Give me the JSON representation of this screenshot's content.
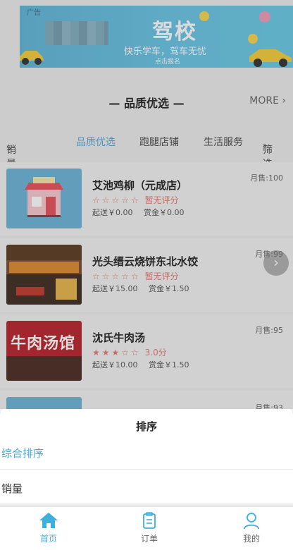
{
  "banner": {
    "ad_tag": "广告",
    "title": "驾校",
    "subtitle": "快乐学车，驾车无忧",
    "cta": "点击报名"
  },
  "section": {
    "title": "— 品质优选 —",
    "more": "MORE",
    "more_icon": "chevron-right-icon"
  },
  "tabs": {
    "sales": "销量",
    "quality": "品质优选",
    "errand": "跑腿店铺",
    "life": "生活服务",
    "filter": "筛选",
    "active_color": "#4fa7d8"
  },
  "shops": [
    {
      "name": "艾池鸡柳（元成店）",
      "sales": "月售:100",
      "stars": "☆☆☆☆☆",
      "rating": "暂无评分",
      "delivery": "起送￥0.00",
      "bounty": "赏金￥0.00"
    },
    {
      "name": "光头缙云烧饼东北水饺",
      "sales": "月售:99",
      "stars": "☆☆☆☆☆",
      "rating": "暂无评分",
      "delivery": "起送￥15.00",
      "bounty": "赏金￥1.50"
    },
    {
      "name": "沈氏牛肉汤",
      "sales": "月售:95",
      "stars": "★★★☆☆",
      "rating": "3.0分",
      "delivery": "起送￥10.00",
      "bounty": "赏金￥1.50",
      "thumb_text": "牛肉汤馆"
    },
    {
      "sales": "月售:93"
    }
  ],
  "sort_sheet": {
    "title": "排序",
    "options": [
      "综合排序",
      "销量"
    ],
    "selected_color": "#45a7d6"
  },
  "nav": {
    "home": "首页",
    "orders": "订单",
    "mine": "我的",
    "active_color": "#3bb0dc"
  }
}
